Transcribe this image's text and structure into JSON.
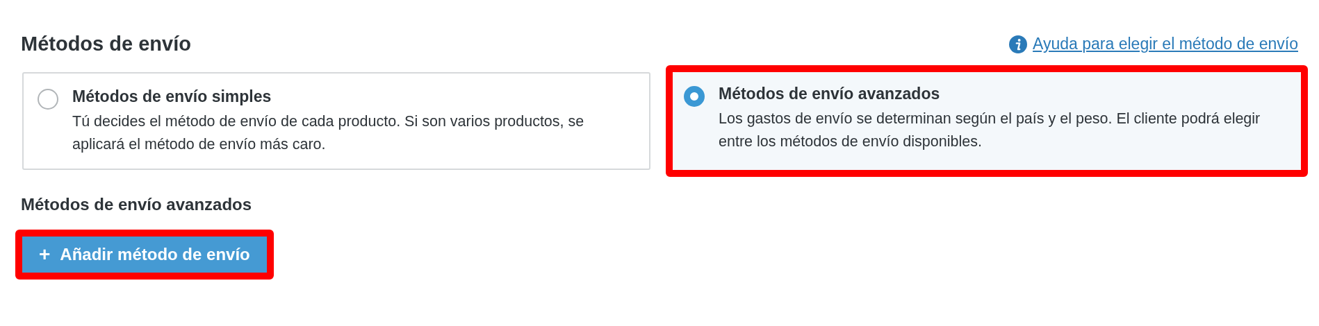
{
  "title": "Métodos de envío",
  "help_link": {
    "label": "Ayuda para elegir el método de envío"
  },
  "options": [
    {
      "title": "Métodos de envío simples",
      "description": "Tú decides el método de envío de cada producto. Si son varios productos, se aplicará el método de envío más caro.",
      "selected": false,
      "highlighted": false
    },
    {
      "title": "Métodos de envío avanzados",
      "description": "Los gastos de envío se determinan según el país y el peso. El cliente podrá elegir entre los métodos de envío disponibles.",
      "selected": true,
      "highlighted": true
    }
  ],
  "section_title": "Métodos de envío avanzados",
  "add_button": {
    "icon": "+",
    "label": "Añadir método de envío",
    "highlighted": true
  }
}
